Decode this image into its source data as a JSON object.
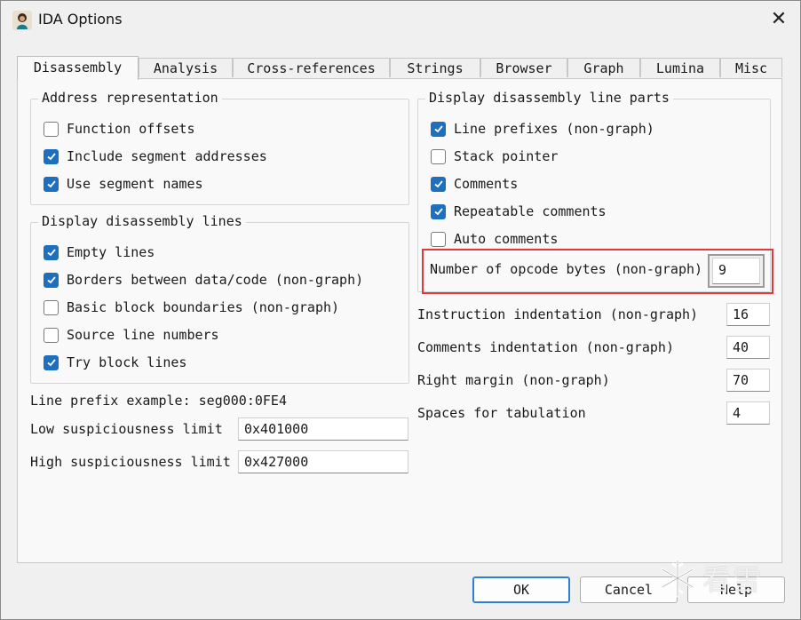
{
  "window": {
    "title": "IDA Options",
    "close_symbol": "✕"
  },
  "tabs": [
    {
      "label": "Disassembly",
      "active": true
    },
    {
      "label": "Analysis"
    },
    {
      "label": "Cross-references"
    },
    {
      "label": "Strings"
    },
    {
      "label": "Browser"
    },
    {
      "label": "Graph"
    },
    {
      "label": "Lumina"
    },
    {
      "label": "Misc"
    }
  ],
  "address_representation": {
    "title": "Address representation",
    "items": [
      {
        "label": "Function offsets",
        "checked": false
      },
      {
        "label": "Include segment addresses",
        "checked": true
      },
      {
        "label": "Use segment names",
        "checked": true
      }
    ]
  },
  "display_lines": {
    "title": "Display disassembly lines",
    "items": [
      {
        "label": "Empty lines",
        "checked": true
      },
      {
        "label": "Borders between data/code (non-graph)",
        "checked": true
      },
      {
        "label": "Basic block boundaries (non-graph)",
        "checked": false
      },
      {
        "label": "Source line numbers",
        "checked": false
      },
      {
        "label": "Try block lines",
        "checked": true
      }
    ]
  },
  "line_prefix_example": "Line prefix example: seg000:0FE4",
  "low_suspiciousness": {
    "label": "Low suspiciousness limit",
    "value": "0x401000"
  },
  "high_suspiciousness": {
    "label": "High suspiciousness limit",
    "value": "0x427000"
  },
  "line_parts": {
    "title": "Display disassembly line parts",
    "items": [
      {
        "label": "Line prefixes (non-graph)",
        "checked": true
      },
      {
        "label": "Stack pointer",
        "checked": false
      },
      {
        "label": "Comments",
        "checked": true
      },
      {
        "label": "Repeatable comments",
        "checked": true
      },
      {
        "label": "Auto comments",
        "checked": false
      }
    ],
    "opcode_bytes": {
      "label": "Number of opcode bytes (non-graph)",
      "value": "9"
    }
  },
  "right_fields": [
    {
      "label": "Instruction indentation (non-graph)",
      "value": "16"
    },
    {
      "label": "Comments indentation (non-graph)",
      "value": "40"
    },
    {
      "label": "Right margin (non-graph)",
      "value": "70"
    },
    {
      "label": "Spaces for tabulation",
      "value": "4"
    }
  ],
  "buttons": {
    "ok": "OK",
    "cancel": "Cancel",
    "help": "Help"
  },
  "watermark": {
    "text": "看雪",
    "icon": "snowflake-icon"
  },
  "colors": {
    "accent": "#1f6fbf",
    "highlight": "#e0393b"
  }
}
